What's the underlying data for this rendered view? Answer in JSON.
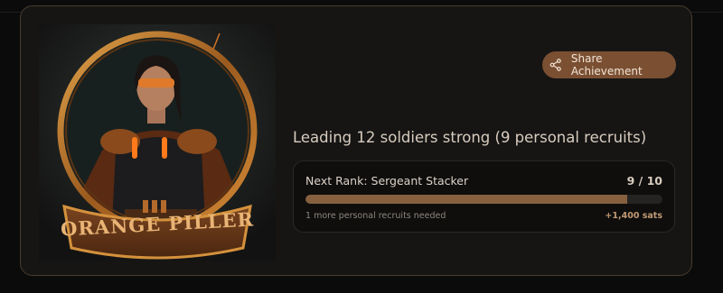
{
  "achievement": {
    "badge_text": "ORANGE PILLER",
    "share_label": "Share Achievement",
    "share_icon": "share-icon",
    "headline": "Leading 12 soldiers strong (9 personal recruits)",
    "next_rank": {
      "title": "Next Rank: Sergeant Stacker",
      "count": "9 / 10",
      "progress": 0.9,
      "needed_text": "1 more personal recruits needed",
      "reward": "+1,400 sats"
    }
  },
  "colors": {
    "accent": "#7a4f32",
    "progress_fill": "#86603f",
    "reward": "#c19a74",
    "border": "#4a3b2c"
  }
}
